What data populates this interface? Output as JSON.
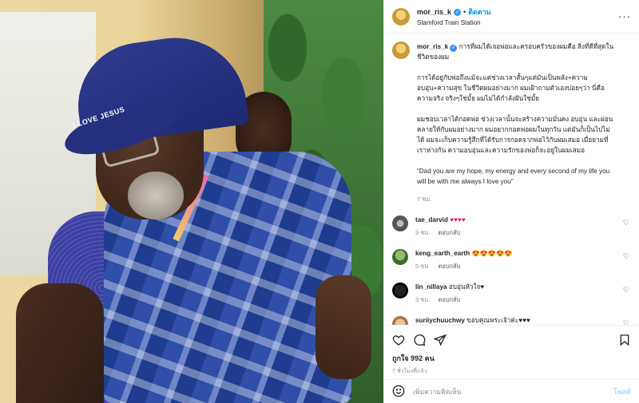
{
  "colors": {
    "accent": "#0095f6",
    "verified": "#3897f0",
    "muted": "#8e8e8e",
    "heart": "#e0245e"
  },
  "photo": {
    "cap_text": "I LOVE JESUS"
  },
  "header": {
    "username": "mor_ris_k",
    "separator": "•",
    "follow_label": "ติดตาม",
    "location": "Stamford Train Station",
    "more_icon": "more-horizontal-icon"
  },
  "caption": {
    "username": "mor_ris_k",
    "line1": "การที่ผมได้เจอพ่อและครอบครัวของผมคือ สิ่งที่ดีที่สุดในชีวิตของผม",
    "para2": "การได้อยู่กับพ่อถึงแม้จะแค่ช่วงเวลาสั้นๆแต่มันเป็นพลัง+ความอบอุ่น+ความสุข ในชีวิตผมอย่างมาก ผมเฝ้าถามตัวเองบ่อยๆว่า นี่คือความจริง จริงๆใช่มั้ย ผมไม่ได้กำลังฝันใช่มั้ย",
    "para3": "ผมชอบเวลาได้กอดพ่อ ช่วงเวลานั้นจะสร้างความมั่นคง อบอุ่น และผ่อนคลายให้กับผมอย่างมาก ผมอยากกอดพ่อผมในทุกวัน แต่มันก็เป็นไปไม่ได้ ผมจะเก็บความรู้สึกที่ได้รับการกอดจากพ่อไว้กับผมเสมอ เมื่อยามที่เราห่างกัน ความอบอุ่นและความรักของพ่อก็จะอยู่ในผมเสมอ",
    "para4": "“Dad you are my hope, my energy and every second of my life you will be with me always I love you”",
    "time": "7 ชม."
  },
  "comments": [
    {
      "username": "tae_darvid",
      "text": "♥♥♥♥",
      "time": "3 ชม.",
      "reply": "ตอบกลับ"
    },
    {
      "username": "keng_earth_earth",
      "text": "😍😍😍😍😍",
      "time": "5 ชม.",
      "reply": "ตอบกลับ"
    },
    {
      "username": "lin_nillaya",
      "text": "อบอุ่นหัวใจ♥",
      "time": "3 ชม.",
      "reply": "ตอบกลับ"
    },
    {
      "username": "suriiychuuchwy",
      "text": "ขอบคุณพระเจ้าค่ะ♥♥♥",
      "time": "",
      "reply": ""
    }
  ],
  "actions": {
    "likes": "ถูกใจ 992 คน",
    "ago": "7 ชั่วโมงที่แล้ว"
  },
  "add_comment": {
    "placeholder": "เพิ่มความคิดเห็น",
    "post_label": "โพสต์"
  }
}
